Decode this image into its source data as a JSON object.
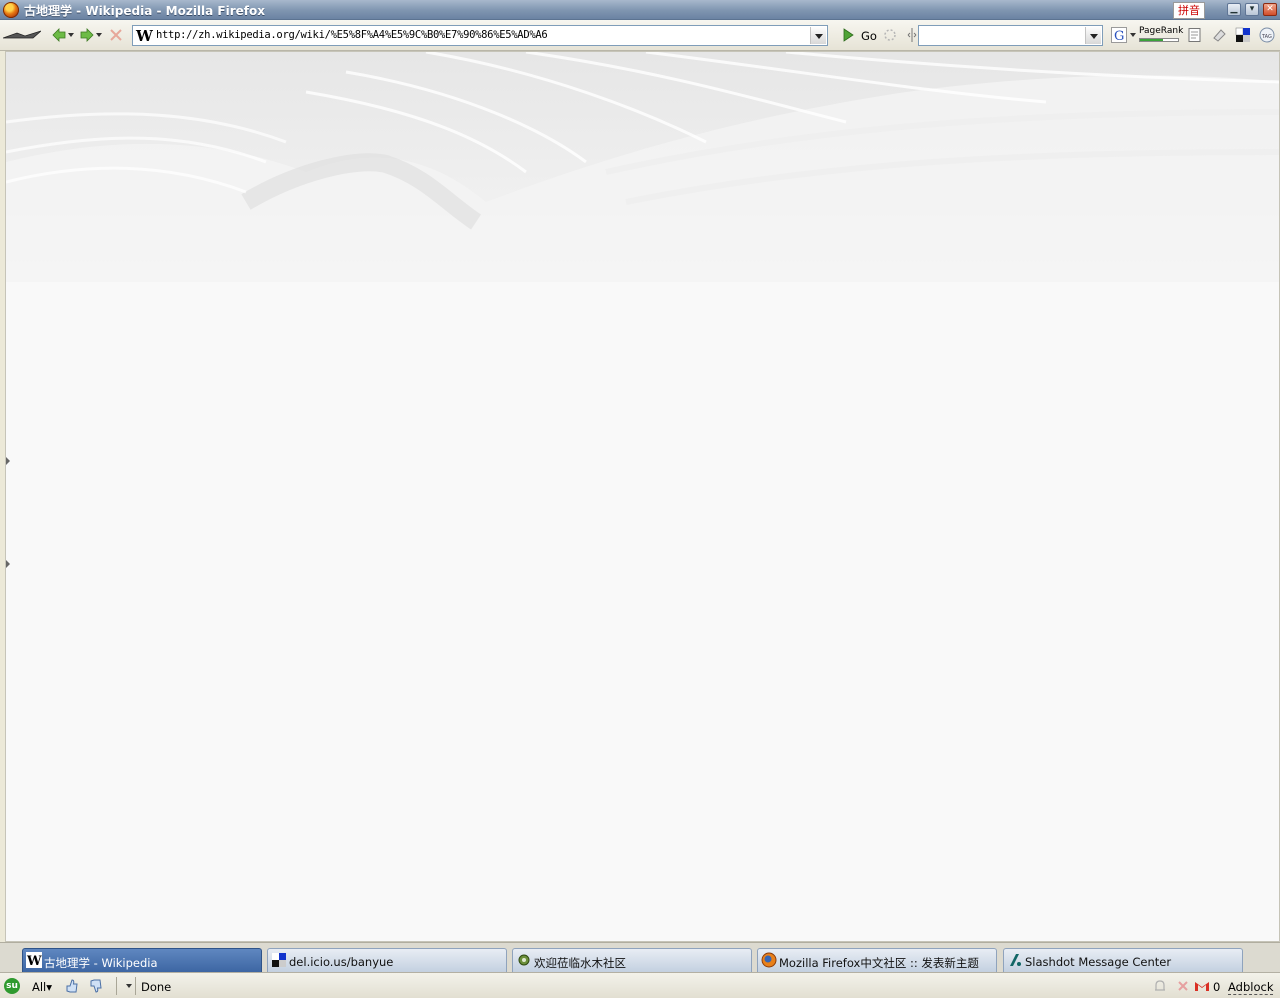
{
  "window": {
    "title": "古地理学 - Wikipedia - Mozilla Firefox",
    "ime_badge": "拼音",
    "minimize_glyph": "▁",
    "maximize_glyph": "▾",
    "close_glyph": "✕"
  },
  "toolbar": {
    "url": "http://zh.wikipedia.org/wiki/%E5%8F%A4%E5%9C%B0%E7%90%86%E5%AD%A6",
    "url_favicon": "W",
    "go_label": "Go",
    "search_value": "",
    "pagerank_label": "PageRank",
    "pagerank_level": 0.6,
    "icons": [
      "logo-icon",
      "back-icon",
      "forward-icon",
      "stop-icon",
      "go-icon",
      "throbber-icon",
      "google-icon",
      "notes-icon",
      "eraser-icon",
      "delicious-icon",
      "tag-icon"
    ]
  },
  "tabs": [
    {
      "label": "古地理学 - Wikipedia",
      "icon": "wikipedia-icon",
      "active": true
    },
    {
      "label": "del.icio.us/banyue",
      "icon": "delicious-icon",
      "active": false
    },
    {
      "label": "欢迎莅临水木社区",
      "icon": "gear-icon",
      "active": false
    },
    {
      "label": "Mozilla Firefox中文社区 :: 发表新主题",
      "icon": "firefox-icon",
      "active": false
    },
    {
      "label": "Slashdot Message Center",
      "icon": "slashdot-icon",
      "active": false
    }
  ],
  "statusbar": {
    "stumble_glyph": "su",
    "filter_label": "All▾",
    "status_text": "Done",
    "gmail_count": "0",
    "adblock_label": "Adblock"
  },
  "colors": {
    "titlebar": "#7f95b0",
    "active_tab": "#3d66a3",
    "page_background": "#f9f9f9"
  }
}
